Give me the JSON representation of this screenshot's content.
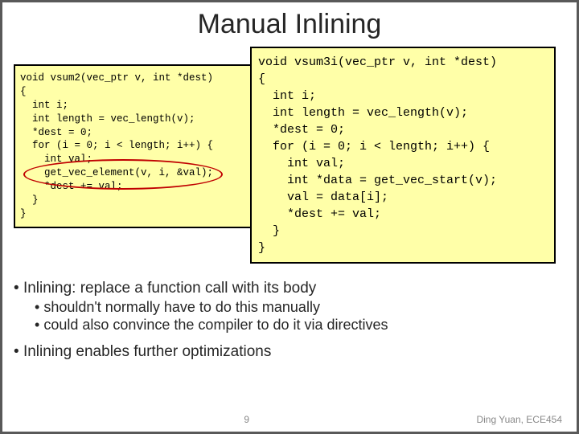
{
  "title": "Manual Inlining",
  "code_left": "void vsum2(vec_ptr v, int *dest)\n{\n  int i;\n  int length = vec_length(v);\n  *dest = 0;\n  for (i = 0; i < length; i++) {\n    int val;\n    get_vec_element(v, i, &val);\n    *dest += val;\n  }\n}",
  "code_right": "void vsum3i(vec_ptr v, int *dest)\n{\n  int i;\n  int length = vec_length(v);\n  *dest = 0;\n  for (i = 0; i < length; i++) {\n    int val;\n    int *data = get_vec_start(v);\n    val = data[i];\n    *dest += val;\n  }\n}",
  "bullets": {
    "b1": "Inlining: replace a function call with its body",
    "b1a": "shouldn't normally have to do this manually",
    "b1b": "could also convince the compiler to do it via directives",
    "b2": "Inlining enables further optimizations"
  },
  "footer": {
    "page": "9",
    "author": "Ding Yuan, ECE454"
  }
}
